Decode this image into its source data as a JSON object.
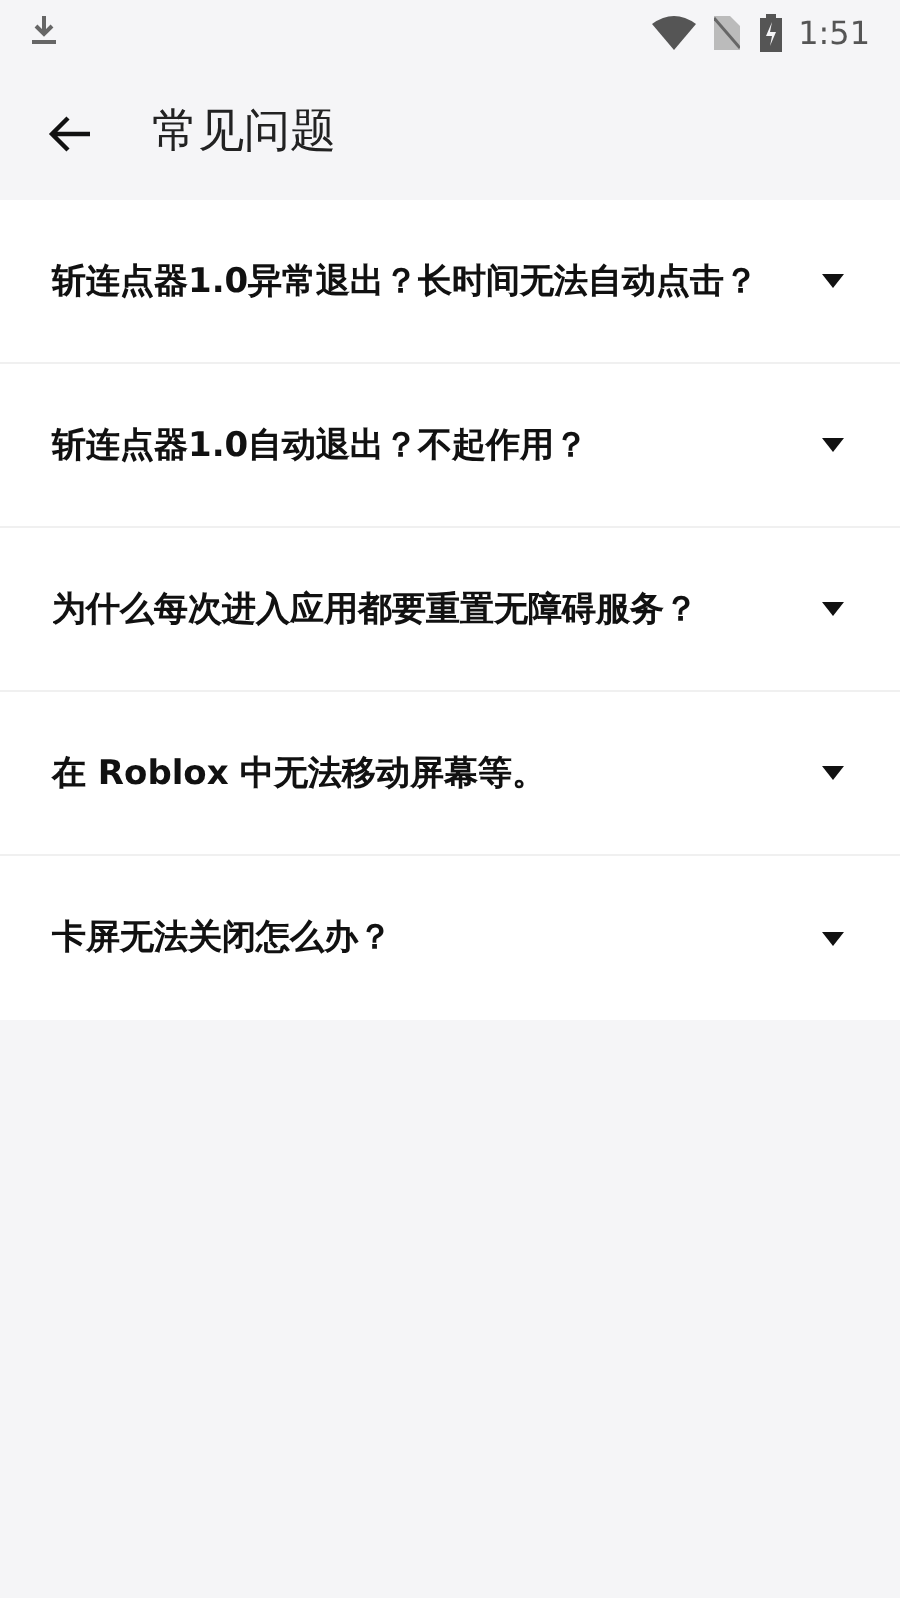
{
  "status_bar": {
    "time": "1:51"
  },
  "header": {
    "title": "常见问题"
  },
  "faq": [
    {
      "question": "斩连点器1.0异常退出？长时间无法自动点击？",
      "expanded": false
    },
    {
      "question": "斩连点器1.0自动退出？不起作用？",
      "expanded": false
    },
    {
      "question": "为什么每次进入应用都要重置无障碍服务？",
      "expanded": false
    },
    {
      "question": "在 Roblox 中无法移动屏幕等。",
      "expanded": false
    },
    {
      "question": "卡屏无法关闭怎么办？",
      "expanded": false
    }
  ]
}
